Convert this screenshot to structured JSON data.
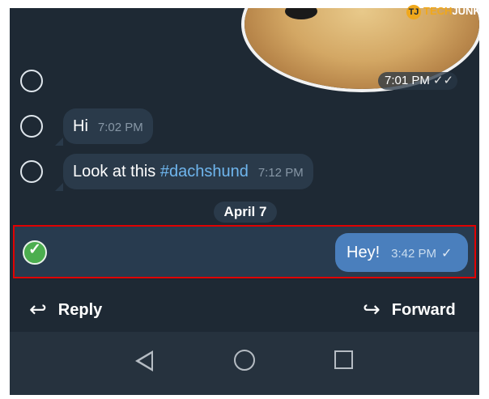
{
  "logo": {
    "mark": "TJ",
    "part1": "TECH",
    "part2": "JUNKIE"
  },
  "messages": {
    "sticker_time": "7:01 PM",
    "sticker_check": "✓✓",
    "msg1": {
      "text": "Hi",
      "time": "7:02 PM"
    },
    "msg2": {
      "text": "Look at this ",
      "hashtag": "#dachshund",
      "time": "7:12 PM"
    },
    "date_separator": "April 7",
    "selected": {
      "text": "Hey!",
      "time": "3:42 PM",
      "check": "✓"
    }
  },
  "actions": {
    "reply_label": "Reply",
    "forward_label": "Forward",
    "reply_icon": "↩",
    "forward_icon": "↪"
  },
  "colors": {
    "background": "#1e2934",
    "incoming_bubble": "#2a3a4a",
    "outgoing_bubble": "#4a7fbd",
    "selection_border": "#e00000",
    "check_green": "#4cae4f",
    "hashtag": "#6fb6ee"
  }
}
